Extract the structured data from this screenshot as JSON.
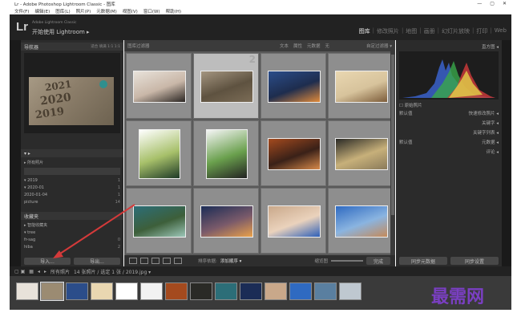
{
  "window": {
    "title": "Lr - Adobe Photoshop Lightroom Classic - 图库",
    "min": "—",
    "max": "▢",
    "close": "✕"
  },
  "menu": [
    "文件(F)",
    "编辑(E)",
    "图库(L)",
    "照片(P)",
    "元数据(M)",
    "视图(V)",
    "窗口(W)",
    "帮助(H)"
  ],
  "header": {
    "logo": "Lr",
    "brand_small": "Adobe Lightroom Classic",
    "brand_title": "开始使用 Lightroom ▸",
    "modules": [
      "图库",
      "修改照片",
      "地图",
      "画册",
      "幻灯片放映",
      "打印",
      "Web"
    ],
    "active_module": "图库"
  },
  "left_panel": {
    "navigator_title": "导航器",
    "navigator_options": "适合 填满 1:1 1:1",
    "catalog_rows": [
      {
        "label": "▸ 所有照片",
        "count": ""
      },
      {
        "label": "▾ 2019",
        "count": "1"
      },
      {
        "label": "  ▾ 2020-01",
        "count": "1"
      },
      {
        "label": "      2020-01-04",
        "count": "1"
      },
      {
        "label": "  picture",
        "count": "14"
      }
    ],
    "collections_title": "收藏夹",
    "collection_rows": [
      {
        "label": "▸ 智能收藏夹",
        "count": ""
      },
      {
        "label": "▾ tree",
        "count": ""
      },
      {
        "label": "   fr-sag",
        "count": "0"
      },
      {
        "label": "   hiba",
        "count": "2"
      }
    ],
    "import_button": "导入...",
    "export_button": "导出..."
  },
  "grid": {
    "header": "图库过滤器",
    "filters": [
      "文本",
      "属性",
      "元数据",
      "无"
    ],
    "preset": "自定过滤器 ▾",
    "selected_number": "2",
    "thumbnails": [
      {
        "name": "portrait-girl",
        "colors": [
          "#e8e2da",
          "#2a2522",
          "#c9b7a8"
        ]
      },
      {
        "name": "years-2021-2020-2019",
        "colors": [
          "#a49580",
          "#7b6c56",
          "#5e5240"
        ]
      },
      {
        "name": "lake-sunset",
        "colors": [
          "#2b4d8a",
          "#e08a3a",
          "#1e2d4e"
        ]
      },
      {
        "name": "calligraphy",
        "colors": [
          "#e9d7b1",
          "#7c5c3a",
          "#d7c39c"
        ]
      },
      {
        "name": "anime-green",
        "colors": [
          "#ffffff",
          "#1e3a26",
          "#a7c06a"
        ]
      },
      {
        "name": "anime-sketch",
        "colors": [
          "#f5f5f5",
          "#222222",
          "#6aa04d"
        ]
      },
      {
        "name": "shiba-dog",
        "colors": [
          "#a44a1e",
          "#d7894a",
          "#3a2118"
        ]
      },
      {
        "name": "desert-figure",
        "colors": [
          "#2a2a26",
          "#8a7a5a",
          "#c7b07a"
        ]
      },
      {
        "name": "river-ice",
        "colors": [
          "#2c6e78",
          "#9cc6b8",
          "#3d5f3a"
        ]
      },
      {
        "name": "mountain-sunrise",
        "colors": [
          "#1b2c56",
          "#e9a14a",
          "#7a5a6a"
        ]
      },
      {
        "name": "blue-bird",
        "colors": [
          "#c9a88a",
          "#2d5fb8",
          "#ead2bc"
        ]
      },
      {
        "name": "dog-lying",
        "colors": [
          "#2f6ac1",
          "#c58a5a",
          "#8ab4e0"
        ]
      }
    ]
  },
  "toolbar": {
    "sort_label": "排序依据:",
    "sort_value": "添加顺序 ▾",
    "thumbs_label": "缩览图",
    "done_button": "完成"
  },
  "right_panel": {
    "histogram_title": "直方图 ◂",
    "original_label": "☐ 原始照片",
    "quick_develop": "快速修改照片 ◂",
    "keywords": "关键字 ◂",
    "keyword_list": "关键字列表 ◂",
    "metadata": "元数据 ◂",
    "comments": "评论 ◂",
    "preset_left": "默认值",
    "preset_left2": "默认值",
    "sync_meta": "同步元数据",
    "sync_settings": "同步设置"
  },
  "filmstrip": {
    "bar_text": "所有照片",
    "info_text": "14 张照片 / 选定 1 张 / 2019.jpg ▾",
    "thumbs": [
      "#e8e2da",
      "#9b8b72",
      "#2b4d8a",
      "#e9d7b1",
      "#ffffff",
      "#f2f2f2",
      "#a44a1e",
      "#2a2a26",
      "#2c6e78",
      "#1b2c56",
      "#c9a88a",
      "#2f6ac1",
      "#5a7fa0",
      "#bfc8d0"
    ]
  },
  "watermark": "最需网",
  "accent": "#d43a3a"
}
